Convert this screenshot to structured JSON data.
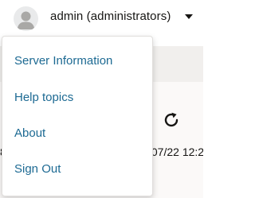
{
  "user": {
    "label": "admin (administrators)"
  },
  "menu": {
    "items": [
      {
        "label": "Server Information"
      },
      {
        "label": "Help topics"
      },
      {
        "label": "About"
      },
      {
        "label": "Sign Out"
      }
    ]
  },
  "background": {
    "date_fragment": "/07/22 12:2",
    "left_fragment": "8"
  },
  "colors": {
    "menu_link": "#1d6a93",
    "text": "#161513",
    "band": "#f1efed"
  }
}
